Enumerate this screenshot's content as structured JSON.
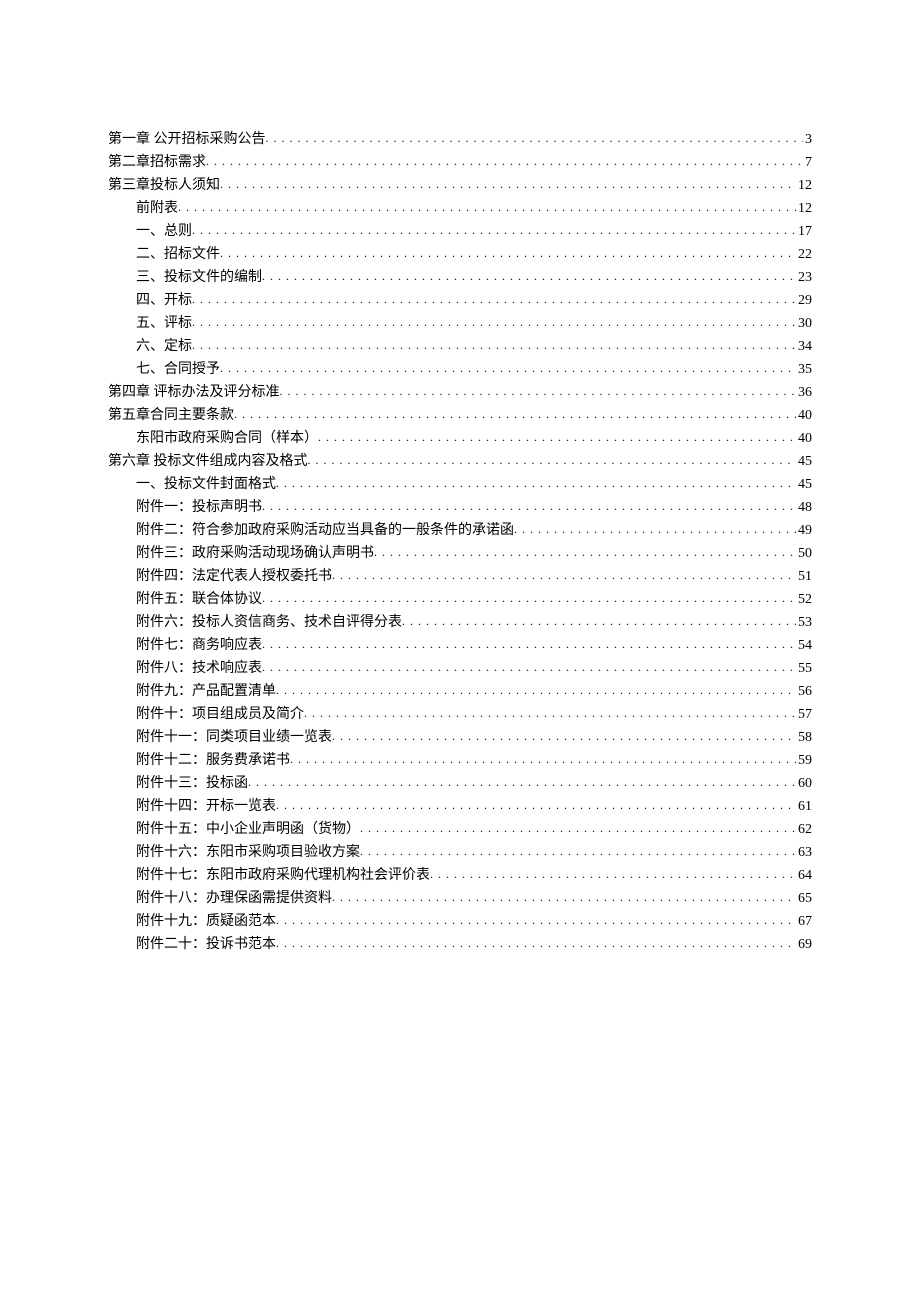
{
  "toc": [
    {
      "level": 0,
      "label": "第一章 公开招标采购公告",
      "page": "3"
    },
    {
      "level": 0,
      "label": "第二章招标需求",
      "page": "7"
    },
    {
      "level": 0,
      "label": "第三章投标人须知",
      "page": "12"
    },
    {
      "level": 1,
      "label": "前附表",
      "page": "12"
    },
    {
      "level": 1,
      "label": "一、总则",
      "page": "17"
    },
    {
      "level": 1,
      "label": "二、招标文件",
      "page": "22"
    },
    {
      "level": 1,
      "label": "三、投标文件的编制",
      "page": "23"
    },
    {
      "level": 1,
      "label": "四、开标",
      "page": "29"
    },
    {
      "level": 1,
      "label": "五、评标",
      "page": "30"
    },
    {
      "level": 1,
      "label": "六、定标",
      "page": "34"
    },
    {
      "level": 1,
      "label": "七、合同授予",
      "page": "35"
    },
    {
      "level": 0,
      "label": "第四章 评标办法及评分标准",
      "page": "36"
    },
    {
      "level": 0,
      "label": "第五章合同主要条款",
      "page": "40"
    },
    {
      "level": 1,
      "label": "东阳市政府采购合同（样本）",
      "page": "40"
    },
    {
      "level": 0,
      "label": "第六章 投标文件组成内容及格式",
      "page": "45"
    },
    {
      "level": 1,
      "label": "一、投标文件封面格式",
      "page": "45"
    },
    {
      "level": 1,
      "label": "附件一：投标声明书",
      "page": "48"
    },
    {
      "level": 1,
      "label": "附件二：符合参加政府采购活动应当具备的一般条件的承诺函",
      "page": "49"
    },
    {
      "level": 1,
      "label": "附件三：政府采购活动现场确认声明书",
      "page": "50"
    },
    {
      "level": 1,
      "label": "附件四：法定代表人授权委托书",
      "page": "51"
    },
    {
      "level": 1,
      "label": "附件五：联合体协议",
      "page": "52"
    },
    {
      "level": 1,
      "label": "附件六：投标人资信商务、技术自评得分表",
      "page": "53"
    },
    {
      "level": 1,
      "label": "附件七：商务响应表",
      "page": "54"
    },
    {
      "level": 1,
      "label": "附件八：技术响应表",
      "page": "55"
    },
    {
      "level": 1,
      "label": "附件九：产品配置清单",
      "page": "56"
    },
    {
      "level": 1,
      "label": "附件十：项目组成员及简介",
      "page": "57"
    },
    {
      "level": 1,
      "label": "附件十一：同类项目业绩一览表",
      "page": "58"
    },
    {
      "level": 1,
      "label": "附件十二：服务费承诺书",
      "page": "59"
    },
    {
      "level": 1,
      "label": "附件十三：投标函",
      "page": "60"
    },
    {
      "level": 1,
      "label": "附件十四：开标一览表",
      "page": "61"
    },
    {
      "level": 1,
      "label": "附件十五：中小企业声明函（货物）",
      "page": "62"
    },
    {
      "level": 1,
      "label": "附件十六：东阳市采购项目验收方案",
      "page": "63"
    },
    {
      "level": 1,
      "label": "附件十七：东阳市政府采购代理机构社会评价表",
      "page": "64"
    },
    {
      "level": 1,
      "label": "附件十八：办理保函需提供资料",
      "page": "65"
    },
    {
      "level": 1,
      "label": "附件十九：质疑函范本",
      "page": "67"
    },
    {
      "level": 1,
      "label": "附件二十：投诉书范本",
      "page": "69"
    }
  ]
}
